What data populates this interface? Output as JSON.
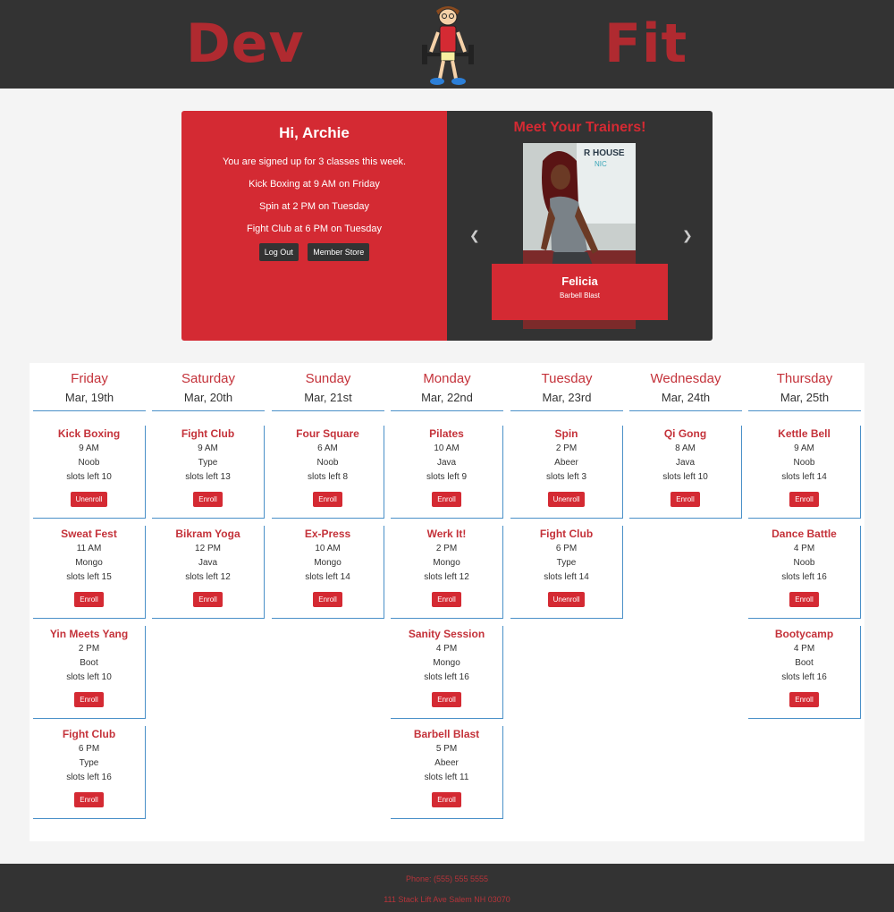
{
  "header": {
    "brand_left": "Dev",
    "brand_right": "Fit",
    "accent_color": "#b02a30"
  },
  "welcome": {
    "greeting": "Hi, Archie",
    "summary": "You are signed up for 3 classes this week.",
    "classes": [
      "Kick Boxing at 9 AM on Friday",
      "Spin at 2 PM on Tuesday",
      "Fight Club at 6 PM on Tuesday"
    ],
    "logout_label": "Log Out",
    "store_label": "Member Store"
  },
  "trainers": {
    "title": "Meet Your Trainers!",
    "current_name": "Felicia",
    "current_class": "Barbell Blast",
    "photo_sign": "R HOUSE",
    "photo_sign2": "NIC"
  },
  "schedule": [
    {
      "day": "Friday",
      "date": "Mar, 19th",
      "classes": [
        {
          "name": "Kick Boxing",
          "time": "9 AM",
          "type": "Noob",
          "slots": "slots left 10",
          "action": "Unenroll"
        },
        {
          "name": "Sweat Fest",
          "time": "11 AM",
          "type": "Mongo",
          "slots": "slots left 15",
          "action": "Enroll"
        },
        {
          "name": "Yin Meets Yang",
          "time": "2 PM",
          "type": "Boot",
          "slots": "slots left 10",
          "action": "Enroll"
        },
        {
          "name": "Fight Club",
          "time": "6 PM",
          "type": "Type",
          "slots": "slots left 16",
          "action": "Enroll"
        }
      ]
    },
    {
      "day": "Saturday",
      "date": "Mar, 20th",
      "classes": [
        {
          "name": "Fight Club",
          "time": "9 AM",
          "type": "Type",
          "slots": "slots left 13",
          "action": "Enroll"
        },
        {
          "name": "Bikram Yoga",
          "time": "12 PM",
          "type": "Java",
          "slots": "slots left 12",
          "action": "Enroll"
        }
      ]
    },
    {
      "day": "Sunday",
      "date": "Mar, 21st",
      "classes": [
        {
          "name": "Four Square",
          "time": "6 AM",
          "type": "Noob",
          "slots": "slots left 8",
          "action": "Enroll"
        },
        {
          "name": "Ex-Press",
          "time": "10 AM",
          "type": "Mongo",
          "slots": "slots left 14",
          "action": "Enroll"
        }
      ]
    },
    {
      "day": "Monday",
      "date": "Mar, 22nd",
      "classes": [
        {
          "name": "Pilates",
          "time": "10 AM",
          "type": "Java",
          "slots": "slots left 9",
          "action": "Enroll"
        },
        {
          "name": "Werk It!",
          "time": "2 PM",
          "type": "Mongo",
          "slots": "slots left 12",
          "action": "Enroll"
        },
        {
          "name": "Sanity Session",
          "time": "4 PM",
          "type": "Mongo",
          "slots": "slots left 16",
          "action": "Enroll"
        },
        {
          "name": "Barbell Blast",
          "time": "5 PM",
          "type": "Abeer",
          "slots": "slots left 11",
          "action": "Enroll"
        }
      ]
    },
    {
      "day": "Tuesday",
      "date": "Mar, 23rd",
      "classes": [
        {
          "name": "Spin",
          "time": "2 PM",
          "type": "Abeer",
          "slots": "slots left 3",
          "action": "Unenroll"
        },
        {
          "name": "Fight Club",
          "time": "6 PM",
          "type": "Type",
          "slots": "slots left 14",
          "action": "Unenroll"
        }
      ]
    },
    {
      "day": "Wednesday",
      "date": "Mar, 24th",
      "classes": [
        {
          "name": "Qi Gong",
          "time": "8 AM",
          "type": "Java",
          "slots": "slots left 10",
          "action": "Enroll"
        }
      ]
    },
    {
      "day": "Thursday",
      "date": "Mar, 25th",
      "classes": [
        {
          "name": "Kettle Bell",
          "time": "9 AM",
          "type": "Noob",
          "slots": "slots left 14",
          "action": "Enroll"
        },
        {
          "name": "Dance Battle",
          "time": "4 PM",
          "type": "Noob",
          "slots": "slots left 16",
          "action": "Enroll"
        },
        {
          "name": "Bootycamp",
          "time": "4 PM",
          "type": "Boot",
          "slots": "slots left 16",
          "action": "Enroll"
        }
      ]
    }
  ],
  "footer": {
    "phone": "Phone: (555) 555 5555",
    "address": "111 Stack Lift Ave Salem NH 03070"
  }
}
